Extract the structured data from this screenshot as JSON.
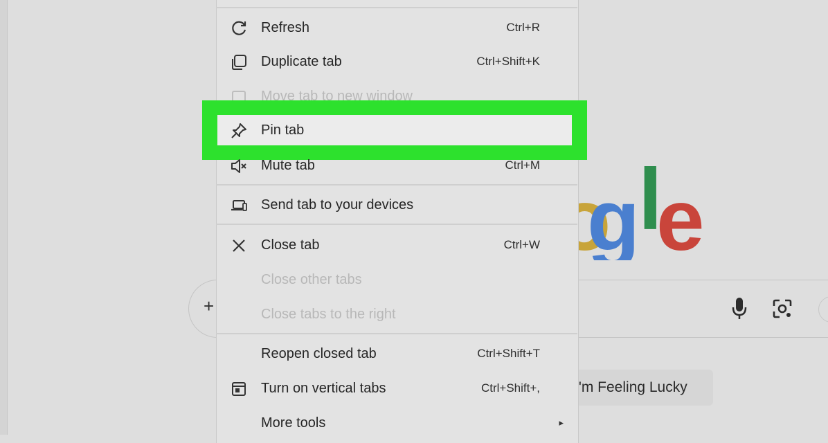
{
  "menu": {
    "items": [
      {
        "label": "Refresh",
        "shortcut": "Ctrl+R",
        "icon": "refresh-icon",
        "enabled": true
      },
      {
        "label": "Duplicate tab",
        "shortcut": "Ctrl+Shift+K",
        "icon": "duplicate-icon",
        "enabled": true
      },
      {
        "label": "Move tab to new window",
        "shortcut": "",
        "icon": "move-window-icon",
        "enabled": false
      },
      {
        "label": "Pin tab",
        "shortcut": "",
        "icon": "pin-icon",
        "enabled": true,
        "highlighted": true
      },
      {
        "label": "Mute tab",
        "shortcut": "Ctrl+M",
        "icon": "mute-icon",
        "enabled": true
      },
      {
        "label": "Send tab to your devices",
        "shortcut": "",
        "icon": "devices-icon",
        "enabled": true
      },
      {
        "label": "Close tab",
        "shortcut": "Ctrl+W",
        "icon": "close-icon",
        "enabled": true
      },
      {
        "label": "Close other tabs",
        "shortcut": "",
        "icon": "",
        "enabled": false
      },
      {
        "label": "Close tabs to the right",
        "shortcut": "",
        "icon": "",
        "enabled": false
      },
      {
        "label": "Reopen closed tab",
        "shortcut": "Ctrl+Shift+T",
        "icon": "",
        "enabled": true
      },
      {
        "label": "Turn on vertical tabs",
        "shortcut": "Ctrl+Shift+,",
        "icon": "vertical-tabs-icon",
        "enabled": true
      },
      {
        "label": "More tools",
        "shortcut": "",
        "icon": "submenu-arrow-icon",
        "enabled": true
      }
    ],
    "highlight_color": "#2de12d"
  },
  "google": {
    "logo_fragment": [
      "o",
      "g",
      "l",
      "e"
    ],
    "lucky_button": "I'm Feeling Lucky"
  },
  "icons": {
    "search_add": "plus-icon",
    "voice": "microphone-icon",
    "lens": "camera-lens-icon"
  }
}
